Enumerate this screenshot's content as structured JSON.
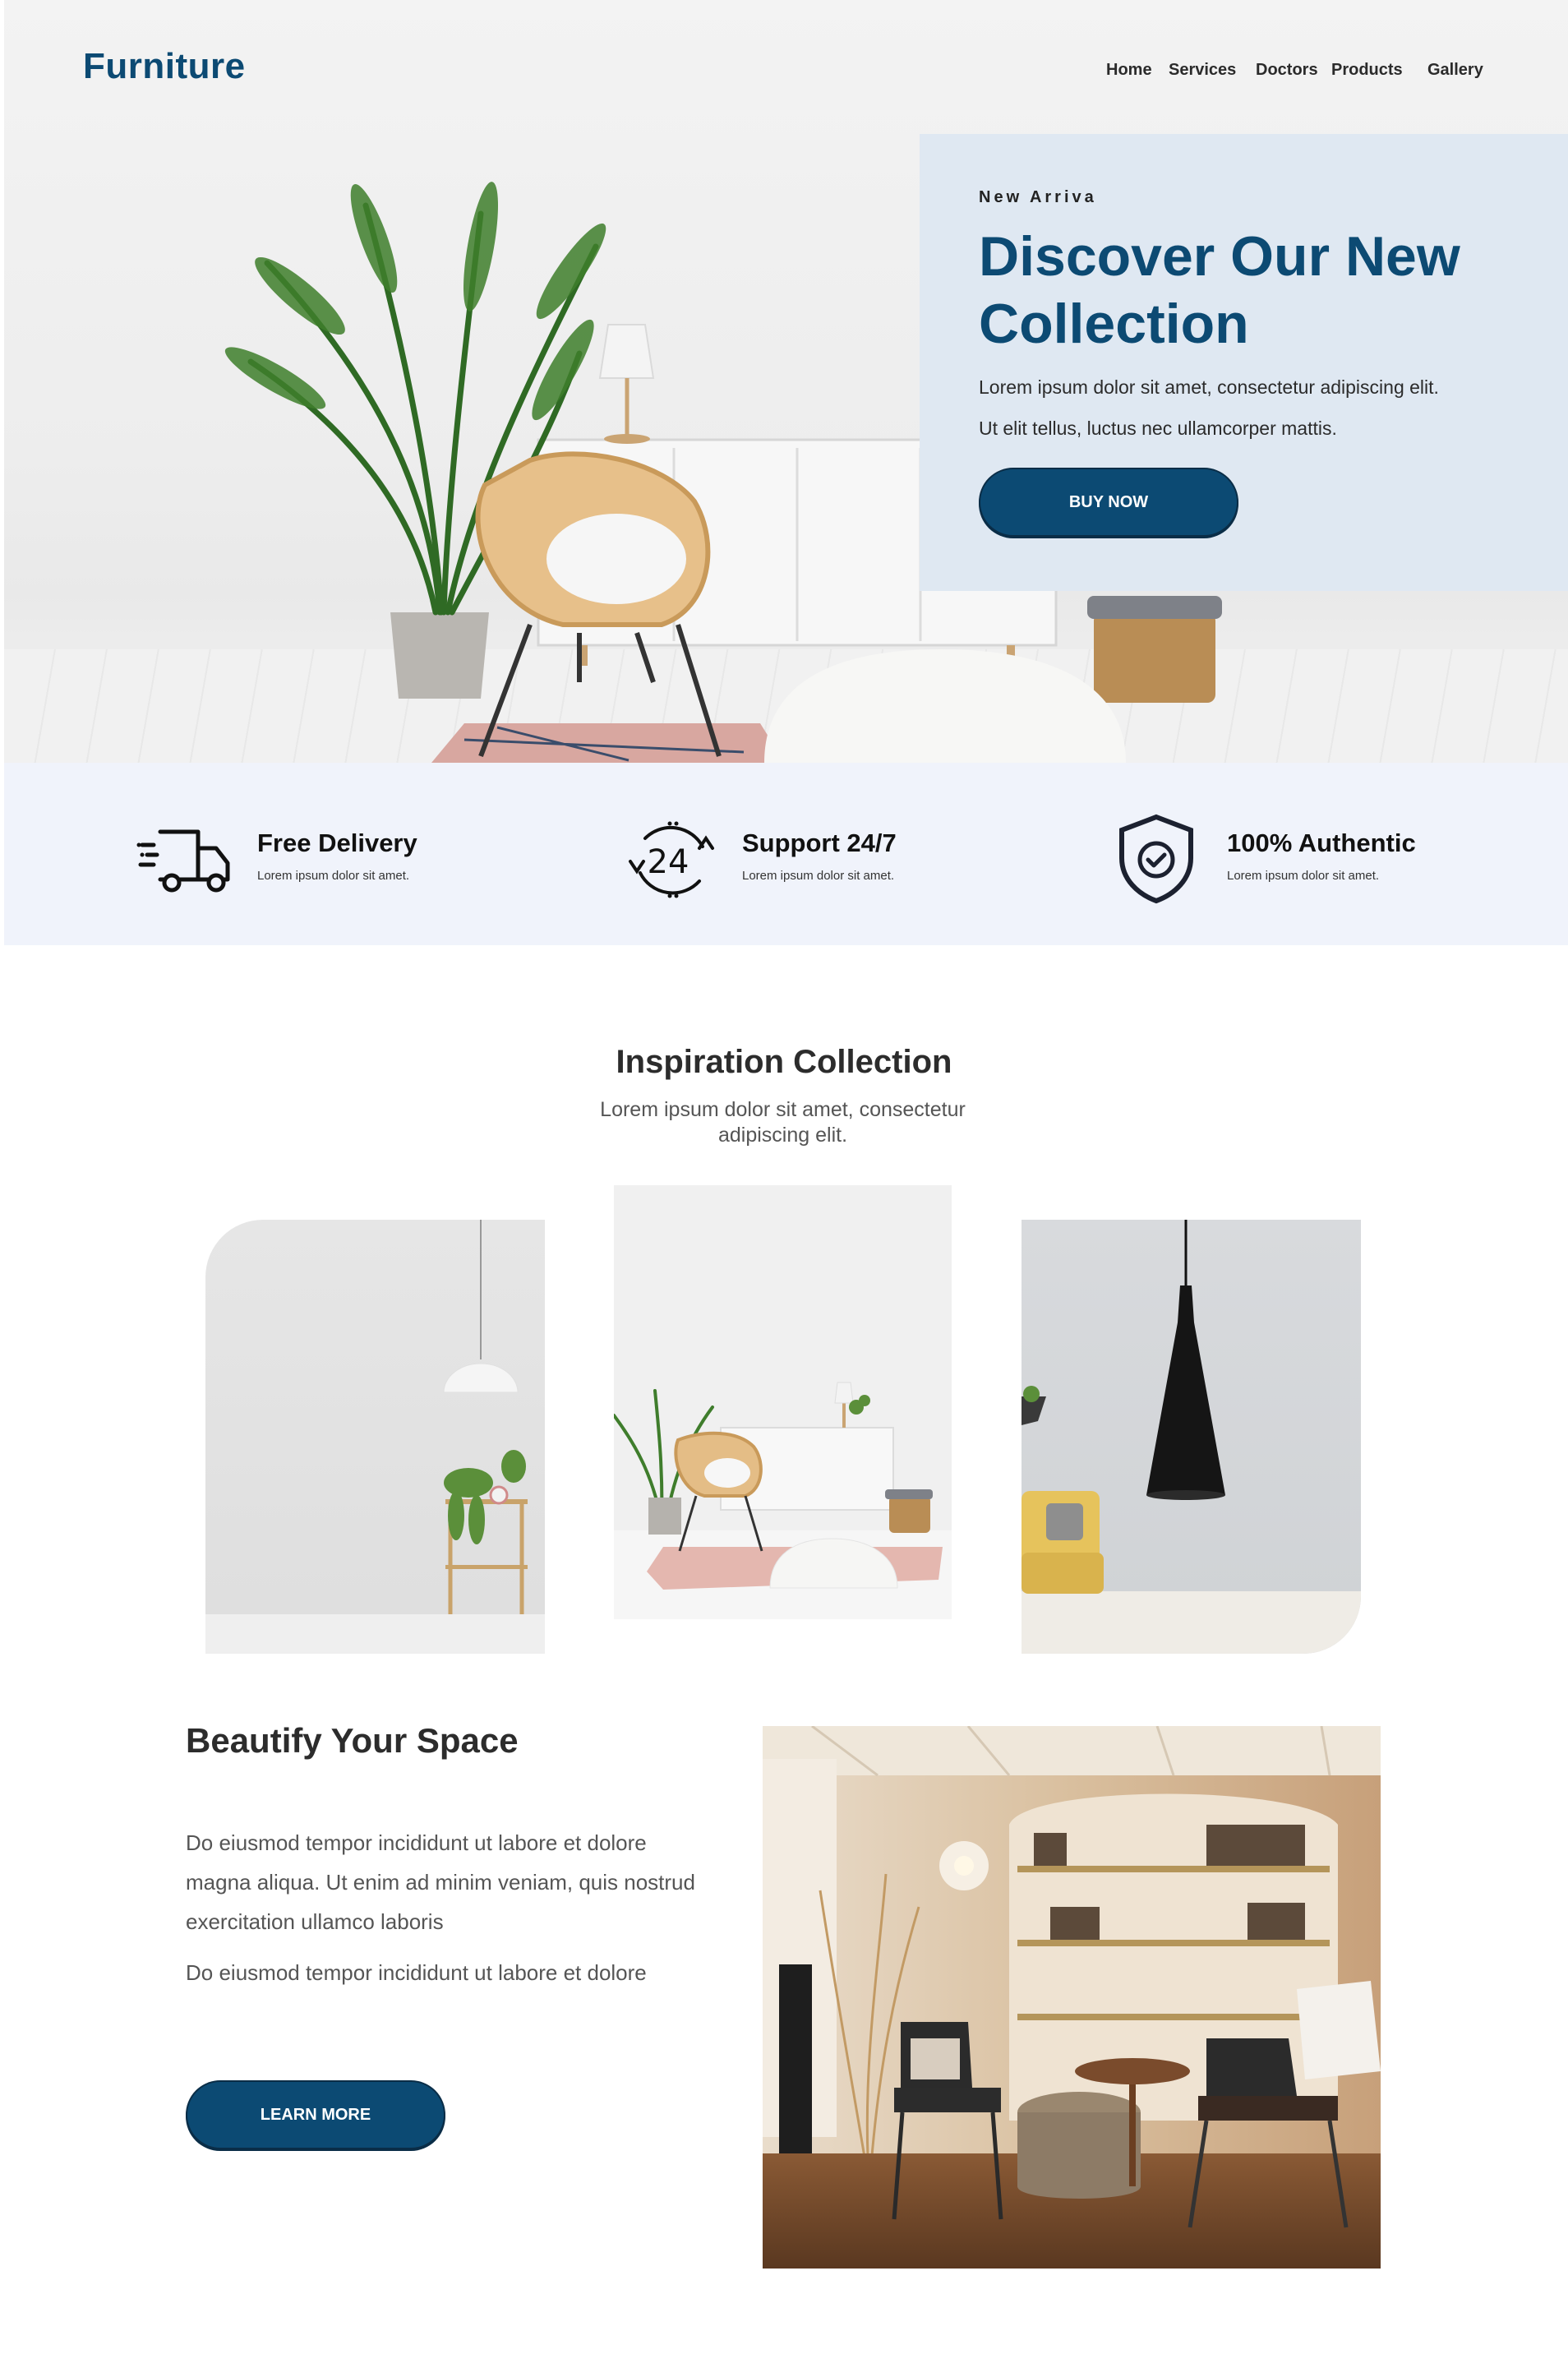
{
  "brand": {
    "name": "Furniture"
  },
  "nav": {
    "items": [
      {
        "label": "Home"
      },
      {
        "label": "Services"
      },
      {
        "label": "Doctors"
      },
      {
        "label": "Products"
      },
      {
        "label": "Gallery"
      }
    ]
  },
  "hero": {
    "kicker": "New Arriva",
    "title": "Discover Our New Collection",
    "line1": "Lorem ipsum dolor sit amet, consectetur adipiscing elit.",
    "line2": "Ut elit tellus, luctus nec ullamcorper mattis.",
    "button": "BUY NOW"
  },
  "features": [
    {
      "icon": "delivery-truck-icon",
      "title": "Free Delivery",
      "text": "Lorem ipsum dolor sit amet."
    },
    {
      "icon": "support-24-7-icon",
      "title": "Support 24/7",
      "text": "Lorem ipsum dolor sit amet."
    },
    {
      "icon": "shield-check-icon",
      "title": "100% Authentic",
      "text": "Lorem ipsum dolor sit amet."
    }
  ],
  "inspiration": {
    "title": "Inspiration Collection",
    "subtitle": "Lorem ipsum dolor sit amet, consectetur adipiscing elit."
  },
  "beautify": {
    "title": "Beautify Your Space",
    "p1": "Do eiusmod tempor incididunt ut labore et dolore magna aliqua. Ut enim ad minim veniam, quis nostrud exercitation ullamco laboris",
    "p2": "Do eiusmod tempor incididunt ut labore et dolore",
    "button": "LEARN MORE"
  },
  "colors": {
    "brand": "#0c4a73",
    "hero_box": "#dfe8f2",
    "features_band": "#f0f3fb"
  }
}
